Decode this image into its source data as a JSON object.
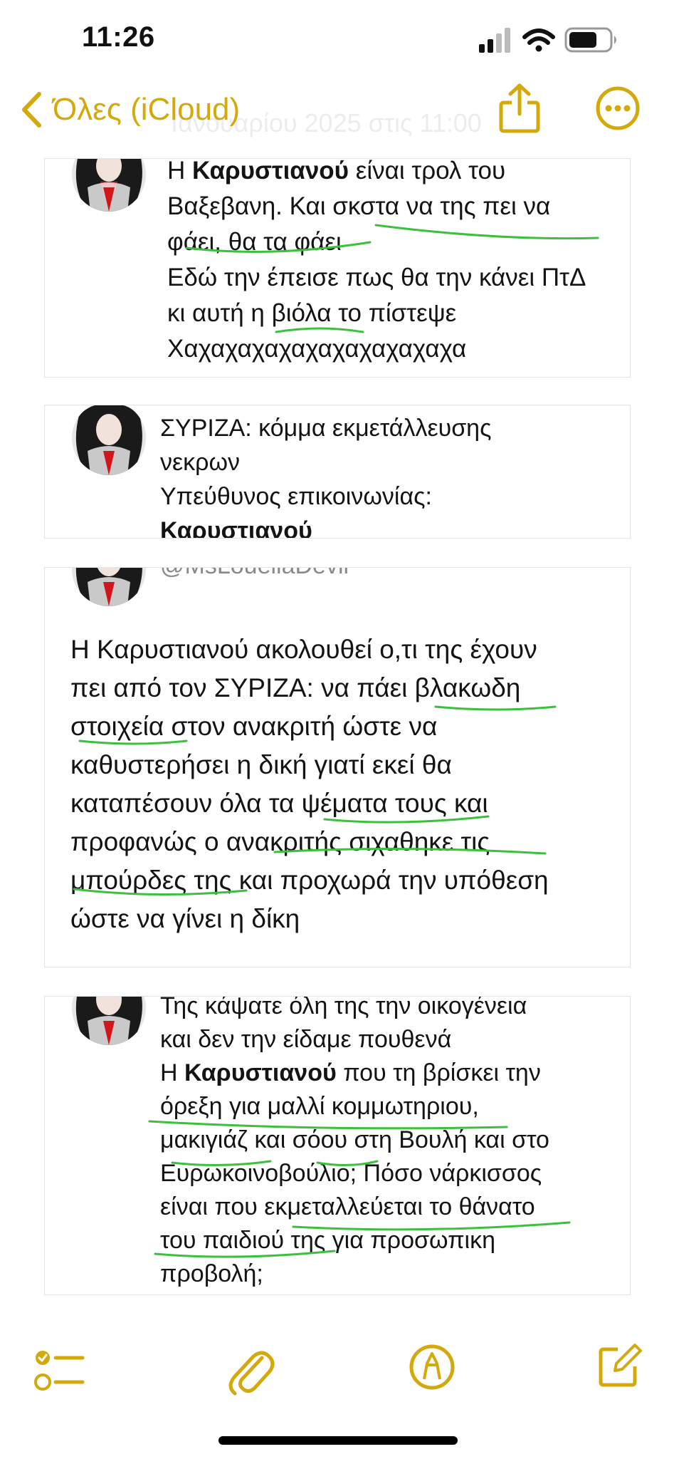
{
  "status_bar": {
    "time": "11:26",
    "icons": [
      "signal-icon",
      "wifi-icon",
      "battery-icon"
    ]
  },
  "nav": {
    "back_label": "Όλες (iCloud)",
    "faded_title": "Ιανουαρίου 2025 στις 11:00",
    "icons": [
      "back-chevron-icon",
      "share-icon",
      "more-icon"
    ]
  },
  "accent_color": "#d4a90c",
  "highlight_color": "#3cc13c",
  "cards": [
    {
      "lines": [
        {
          "pre": "Η ",
          "bold": "Καρυστιανού",
          "post": " είναι τρολ του"
        },
        {
          "pre": "Βαξεβανη. Και σκστα να της πει να",
          "bold": "",
          "post": ""
        },
        {
          "pre": "φάει, θα τα φάει",
          "bold": "",
          "post": ""
        },
        {
          "pre": "Εδώ την έπεισε πως θα την κάνει ΠτΔ",
          "bold": "",
          "post": ""
        },
        {
          "pre": "κι αυτή η βιόλα το πίστεψε",
          "bold": "",
          "post": ""
        },
        {
          "pre": "Χαχαχαχαχαχαχαχαχαχαχα",
          "bold": "",
          "post": ""
        }
      ]
    },
    {
      "lines": [
        {
          "pre": "ΣΥΡΙΖΑ: κόμμα εκμετάλλευσης",
          "bold": "",
          "post": ""
        },
        {
          "pre": "νεκρων",
          "bold": "",
          "post": ""
        },
        {
          "pre": "Υπεύθυνος επικοινωνίας:",
          "bold": "",
          "post": ""
        },
        {
          "pre": "",
          "bold": "Καρυστιανού",
          "post": ""
        }
      ]
    },
    {
      "handle": "@MsLouellaDevil",
      "lines": [
        {
          "pre": "Η Καρυστιανού ακολουθεί ο,τι της έχουν",
          "bold": "",
          "post": ""
        },
        {
          "pre": "πει από τον ΣΥΡΙΖΑ: να πάει βλακωδη",
          "bold": "",
          "post": ""
        },
        {
          "pre": "στοιχεία στον ανακριτή ώστε να",
          "bold": "",
          "post": ""
        },
        {
          "pre": "καθυστερήσει η δική γιατί εκεί θα",
          "bold": "",
          "post": ""
        },
        {
          "pre": "καταπέσουν όλα τα ψέματα τους και",
          "bold": "",
          "post": ""
        },
        {
          "pre": "προφανώς ο ανακριτής σιχαθηκε τις",
          "bold": "",
          "post": ""
        },
        {
          "pre": "μπούρδες της και προχωρά την υπόθεση",
          "bold": "",
          "post": ""
        },
        {
          "pre": "ώστε να γίνει η δίκη",
          "bold": "",
          "post": ""
        }
      ]
    },
    {
      "lines": [
        {
          "pre": "Της κάψατε όλη της την οικογένεια",
          "bold": "",
          "post": ""
        },
        {
          "pre": "και δεν την είδαμε πουθενά",
          "bold": "",
          "post": ""
        },
        {
          "pre": "Η ",
          "bold": "Καρυστιανού",
          "post": " που τη βρίσκει την"
        },
        {
          "pre": "όρεξη για μαλλί κομμωτηριου,",
          "bold": "",
          "post": ""
        },
        {
          "pre": "μακιγιάζ και σόου στη Βουλή και στο",
          "bold": "",
          "post": ""
        },
        {
          "pre": "Ευρωκοινοβούλιο; Πόσο νάρκισσος",
          "bold": "",
          "post": ""
        },
        {
          "pre": "είναι που εκμεταλλεύεται το θάνατο",
          "bold": "",
          "post": ""
        },
        {
          "pre": "του παιδιού της για προσωπικη",
          "bold": "",
          "post": ""
        },
        {
          "pre": "προβολή;",
          "bold": "",
          "post": ""
        }
      ]
    }
  ],
  "toolbar": {
    "icons": [
      "checklist-icon",
      "attachment-icon",
      "markup-icon",
      "compose-icon"
    ]
  }
}
